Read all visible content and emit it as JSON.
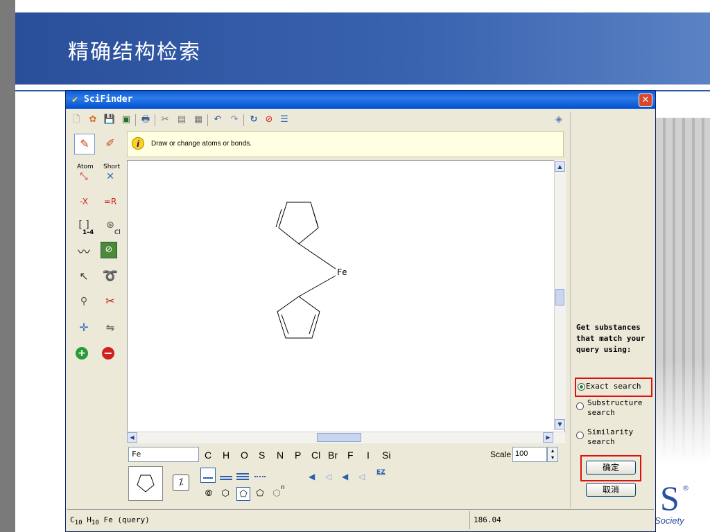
{
  "slide": {
    "title": "精确结构检索",
    "acs_glyph": "S",
    "acs_reg": "®",
    "acs_society": "Society"
  },
  "window": {
    "title": "SciFinder",
    "close_label": "✕"
  },
  "hint": {
    "text": "Draw or change atoms or bonds."
  },
  "palette": {
    "atom_label": "Atom",
    "short_label": "Short",
    "x_label": "-X",
    "r_label": "=R",
    "bracket_label": "[ ]",
    "range_label": "1-4",
    "cl_label": "Cl"
  },
  "molecule": {
    "atom_label": "Fe"
  },
  "editor": {
    "element_value": "Fe",
    "elements": [
      "C",
      "H",
      "O",
      "S",
      "N",
      "P",
      "Cl",
      "Br",
      "F",
      "I",
      "Si"
    ],
    "scale_label": "Scale",
    "scale_value": "100",
    "ez_label": "EZ",
    "ring_n": "n"
  },
  "search_panel": {
    "prompt": "Get substances that match your query using:",
    "options": [
      {
        "label": "Exact search",
        "selected": true
      },
      {
        "label": "Substructure search",
        "selected": false
      },
      {
        "label": "Similarity search",
        "selected": false
      }
    ],
    "ok_label": "确定",
    "cancel_label": "取消"
  },
  "status": {
    "formula_prefix": "C",
    "c_count": "10",
    "h_prefix": " H",
    "h_count": "10",
    "formula_suffix": " Fe (query)",
    "mass": "186.04"
  },
  "colors": {
    "highlight_red": "#e01010",
    "banner_blue": "#2a4f9a",
    "titlebar_blue": "#0a5bd8"
  }
}
